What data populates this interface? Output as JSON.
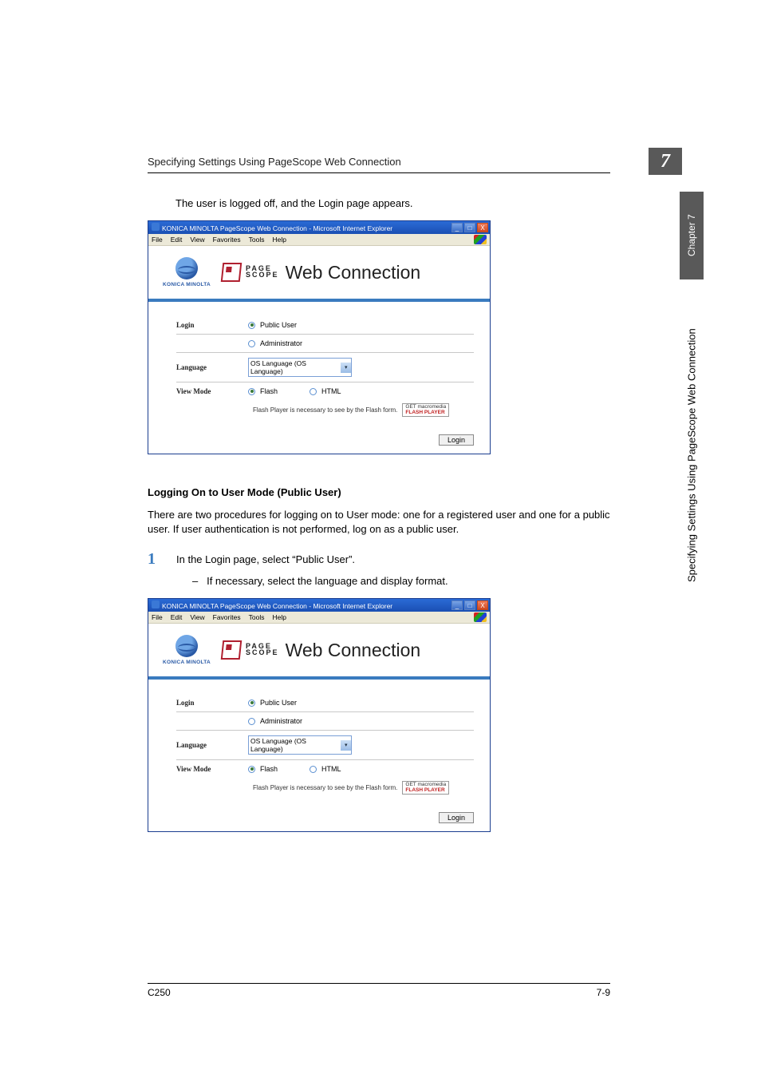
{
  "header": {
    "running_title": "Specifying Settings Using PageScope Web Connection",
    "chapter_number": "7",
    "side_tab": "Chapter 7",
    "side_label": "Specifying Settings Using PageScope Web Connection"
  },
  "intro_line": "The user is logged off, and the Login page appears.",
  "section": {
    "title": "Logging On to User Mode (Public User)",
    "para": "There are two procedures for logging on to User mode: one for a registered user and one for a public user. If user authentication is not performed, log on as a public user.",
    "step1_num": "1",
    "step1_text": "In the Login page, select “Public User”.",
    "substep_dash": "–",
    "substep_text": "If necessary, select the language and display format."
  },
  "browser": {
    "title": "KONICA MINOLTA PageScope Web Connection - Microsoft Internet Explorer",
    "menus": [
      "File",
      "Edit",
      "View",
      "Favorites",
      "Tools",
      "Help"
    ],
    "win_min": "_",
    "win_max": "□",
    "win_close": "X"
  },
  "brand": {
    "km": "KONICA MINOLTA",
    "ps_page": "PAGE",
    "ps_scope": "SCOPE",
    "wc": "Web Connection"
  },
  "form": {
    "login_label": "Login",
    "public_user": "Public User",
    "administrator": "Administrator",
    "language_label": "Language",
    "language_value": "OS Language (OS Language)",
    "viewmode_label": "View Mode",
    "flash": "Flash",
    "html": "HTML",
    "flash_note": "Flash Player is necessary to see by the Flash form.",
    "flash_badge_top": "GET macromedia",
    "flash_badge_bottom": "FLASH PLAYER",
    "login_button": "Login"
  },
  "footer": {
    "left": "C250",
    "right": "7-9"
  }
}
